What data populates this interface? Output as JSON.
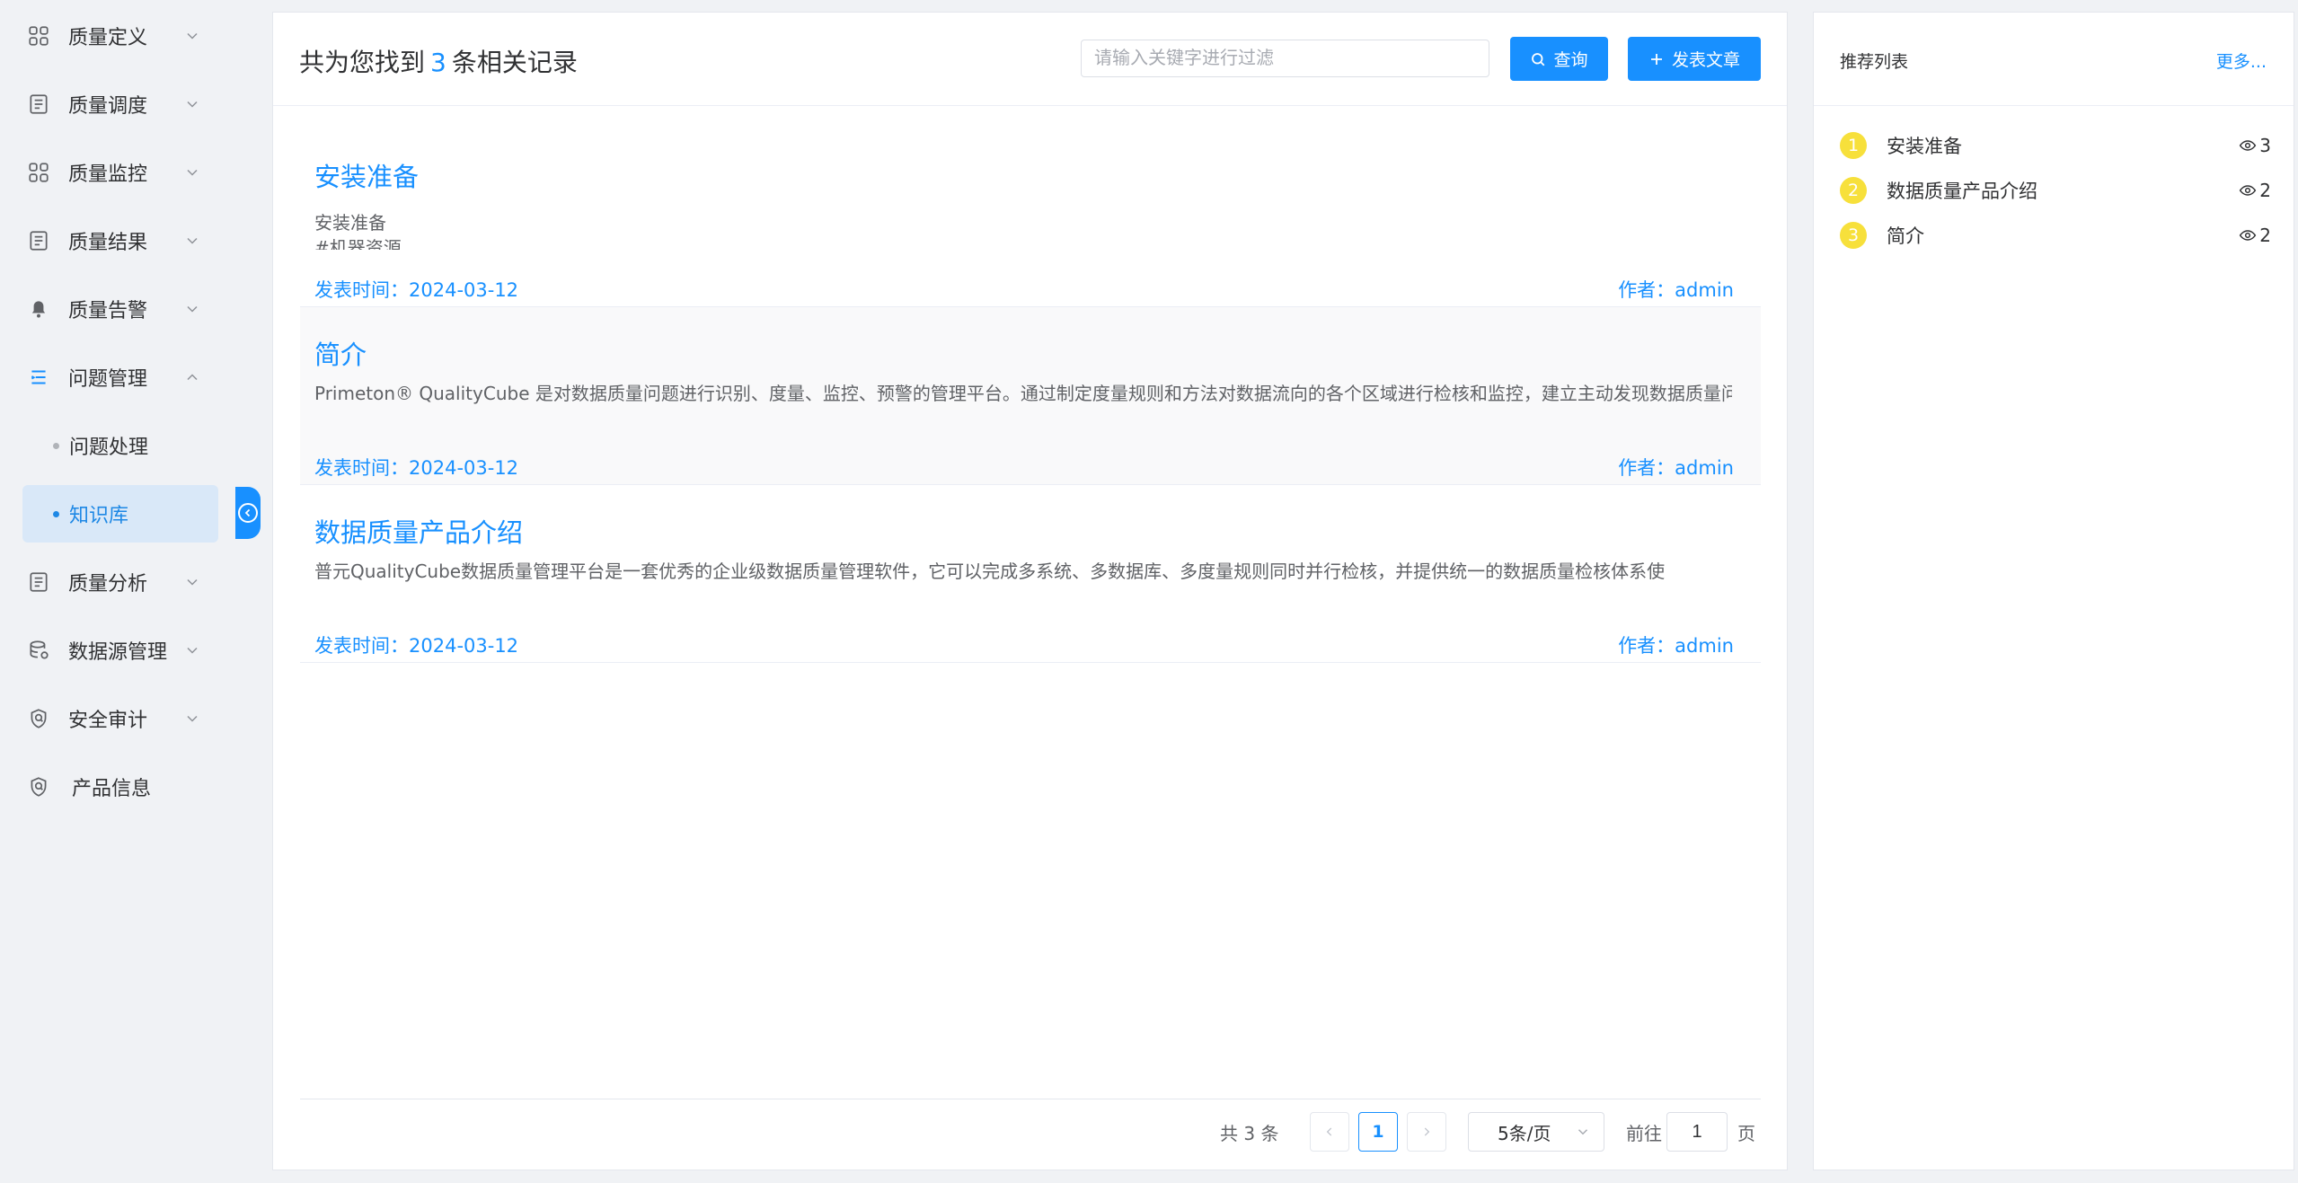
{
  "sidebar": {
    "items": [
      {
        "label": "质量定义",
        "icon": "grid-icon"
      },
      {
        "label": "质量调度",
        "icon": "document-icon"
      },
      {
        "label": "质量监控",
        "icon": "grid-icon"
      },
      {
        "label": "质量结果",
        "icon": "document-icon"
      },
      {
        "label": "质量告警",
        "icon": "bell-icon"
      },
      {
        "label": "问题管理",
        "icon": "list-icon",
        "expanded": true
      },
      {
        "label": "质量分析",
        "icon": "document-icon"
      },
      {
        "label": "数据源管理",
        "icon": "database-icon"
      },
      {
        "label": "安全审计",
        "icon": "shield-icon"
      },
      {
        "label": "产品信息",
        "icon": "shield-icon"
      }
    ],
    "subitems": [
      {
        "label": "问题处理",
        "active": false
      },
      {
        "label": "知识库",
        "active": true
      }
    ]
  },
  "main": {
    "result_prefix": "共为您找到",
    "result_count": "3",
    "result_suffix": "条相关记录",
    "search_placeholder": "请输入关键字进行过滤",
    "query_button": "查询",
    "publish_button": "发表文章",
    "articles": [
      {
        "title": "安装准备",
        "summary": "安装准备\n#机器资源",
        "date": "发表时间：2024-03-12",
        "author": "作者：admin"
      },
      {
        "title": "简介",
        "summary": "Primeton® QualityCube 是对数据质量问题进行识别、度量、监控、预警的管理平台。通过制定度量规则和方法对数据流向的各个区域进行检核和监控，建立主动发现数据质量问题的机制",
        "date": "发表时间：2024-03-12",
        "author": "作者：admin"
      },
      {
        "title": "数据质量产品介绍",
        "summary": " 普元QualityCube数据质量管理平台是一套优秀的企业级数据质量管理软件，它可以完成多系统、多数据库、多度量规则同时并行检核，并提供统一的数据质量检核体系使",
        "date": "发表时间：2024-03-12",
        "author": "作者：admin"
      }
    ],
    "pager": {
      "total": "共 3 条",
      "current_page": "1",
      "page_size": "5条/页",
      "goto_label": "前往",
      "goto_value": "1",
      "page_label": "页"
    }
  },
  "recommend": {
    "title": "推荐列表",
    "more": "更多...",
    "items": [
      {
        "rank": "1",
        "title": "安装准备",
        "views": "3"
      },
      {
        "rank": "2",
        "title": "数据质量产品介绍",
        "views": "2"
      },
      {
        "rank": "3",
        "title": "简介",
        "views": "2"
      }
    ]
  },
  "colors": {
    "accent": "#1890ff",
    "rank_badge": "#f7e03b",
    "active_submenu_bg": "#d9e8f8"
  }
}
